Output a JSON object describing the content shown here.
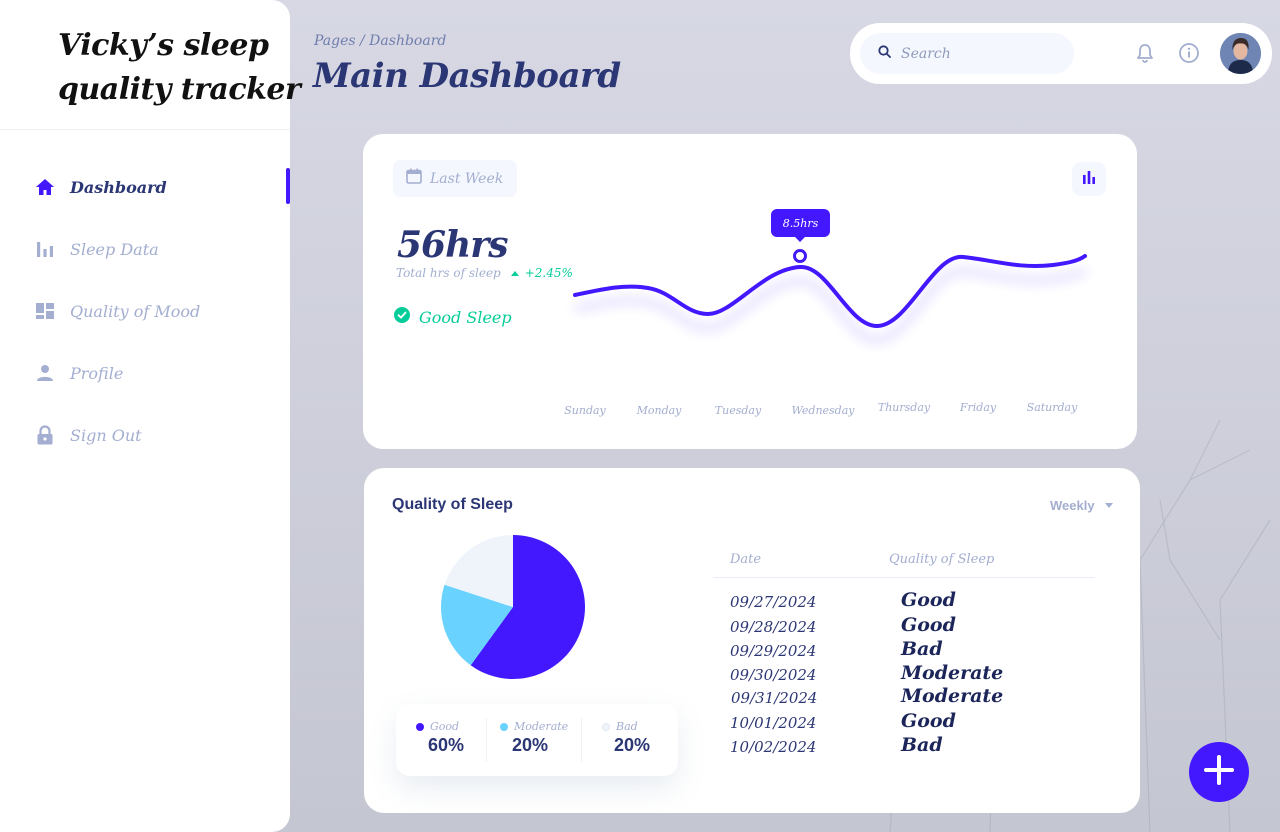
{
  "app": {
    "brand_line1": "Vicky’s sleep",
    "brand_line2": "quality tracker"
  },
  "sidebar": {
    "items": [
      {
        "label": "Dashboard",
        "icon": "home-icon",
        "active": true
      },
      {
        "label": "Sleep Data",
        "icon": "bar-chart-icon",
        "active": false
      },
      {
        "label": "Quality of Mood",
        "icon": "dashboard-grid-icon",
        "active": false
      },
      {
        "label": "Profile",
        "icon": "person-icon",
        "active": false
      },
      {
        "label": "Sign Out",
        "icon": "lock-icon",
        "active": false
      }
    ]
  },
  "header": {
    "breadcrumb": "Pages / Dashboard",
    "title": "Main Dashboard",
    "search_placeholder": "Search"
  },
  "summary": {
    "period": "Last Week",
    "total": "56hrs",
    "total_label": "Total hrs of sleep",
    "change": "+2.45%",
    "status": "Good Sleep"
  },
  "chart_data": {
    "type": "line",
    "categories": [
      "Sunday",
      "Monday",
      "Tuesday",
      "Wednesday",
      "Thursday",
      "Friday",
      "Saturday"
    ],
    "highlight": {
      "category": "Wednesday",
      "label": "8.5hrs"
    }
  },
  "quality": {
    "title": "Quality of Sleep",
    "range": "Weekly",
    "pie": [
      {
        "name": "Good",
        "value": 60,
        "display": "60%",
        "color": "#4318ff"
      },
      {
        "name": "Moderate",
        "value": 20,
        "display": "20%",
        "color": "#6ad2ff"
      },
      {
        "name": "Bad",
        "value": 20,
        "display": "20%",
        "color": "#eff4fb"
      }
    ],
    "table": {
      "headers": [
        "Date",
        "Quality of Sleep"
      ],
      "rows": [
        {
          "date": "09/27/2024",
          "quality": "Good"
        },
        {
          "date": "09/28/2024",
          "quality": "Good"
        },
        {
          "date": "09/29/2024",
          "quality": "Bad"
        },
        {
          "date": "09/30/2024",
          "quality": "Moderate"
        },
        {
          "date": "09/31/2024",
          "quality": "Moderate"
        },
        {
          "date": "10/01/2024",
          "quality": "Good"
        },
        {
          "date": "10/02/2024",
          "quality": "Bad"
        }
      ]
    }
  },
  "colors": {
    "accent": "#4318ff",
    "text_primary": "#2b3674",
    "text_secondary": "#a3aed0",
    "success": "#05cd99"
  }
}
